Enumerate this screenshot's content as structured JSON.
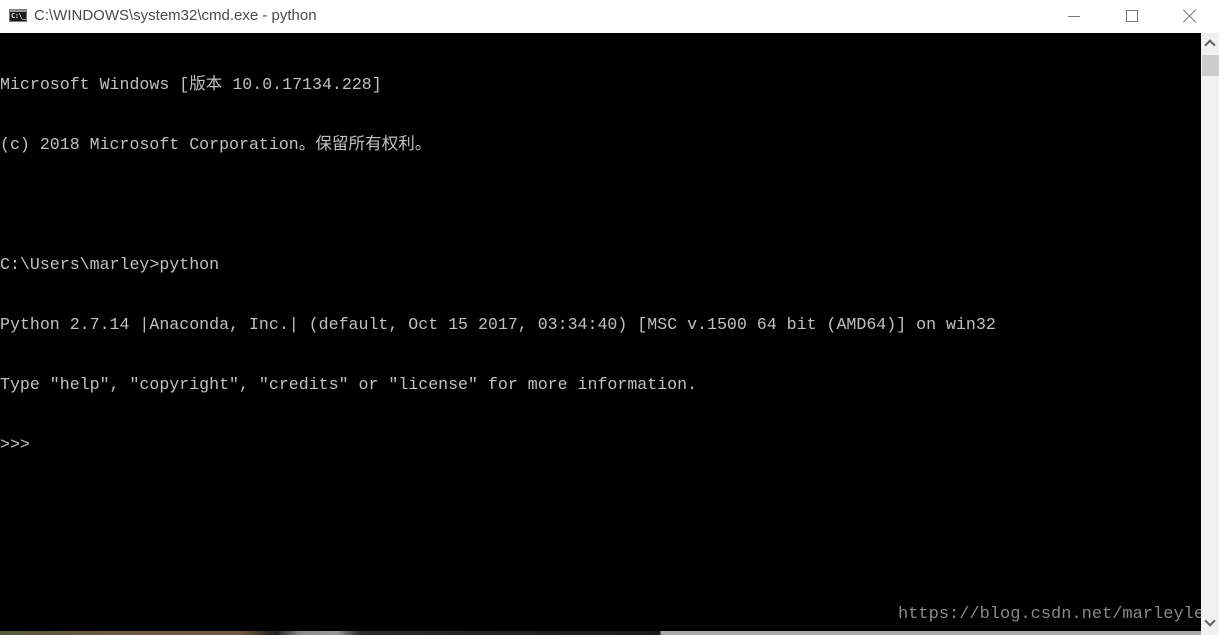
{
  "window": {
    "title": "C:\\WINDOWS\\system32\\cmd.exe - python",
    "app_icon": "cmd-icon",
    "app_icon_text": "C:\\_",
    "controls": {
      "minimize": "minimize-icon",
      "maximize": "maximize-icon",
      "close": "close-icon"
    }
  },
  "console": {
    "lines": [
      "Microsoft Windows [版本 10.0.17134.228]",
      "(c) 2018 Microsoft Corporation。保留所有权利。",
      "",
      "C:\\Users\\marley>python",
      "Python 2.7.14 |Anaconda, Inc.| (default, Oct 15 2017, 03:34:40) [MSC v.1500 64 bit (AMD64)] on win32",
      "Type \"help\", \"copyright\", \"credits\" or \"license\" for more information.",
      ">>> "
    ],
    "prompt": ">>>",
    "colors": {
      "background": "#000000",
      "foreground": "#c0c0c0"
    }
  },
  "watermark": {
    "text": "https://blog.csdn.net/marleylee"
  },
  "scrollbar": {
    "up_icon": "chevron-up-icon",
    "down_icon": "chevron-down-icon",
    "position": 0
  }
}
